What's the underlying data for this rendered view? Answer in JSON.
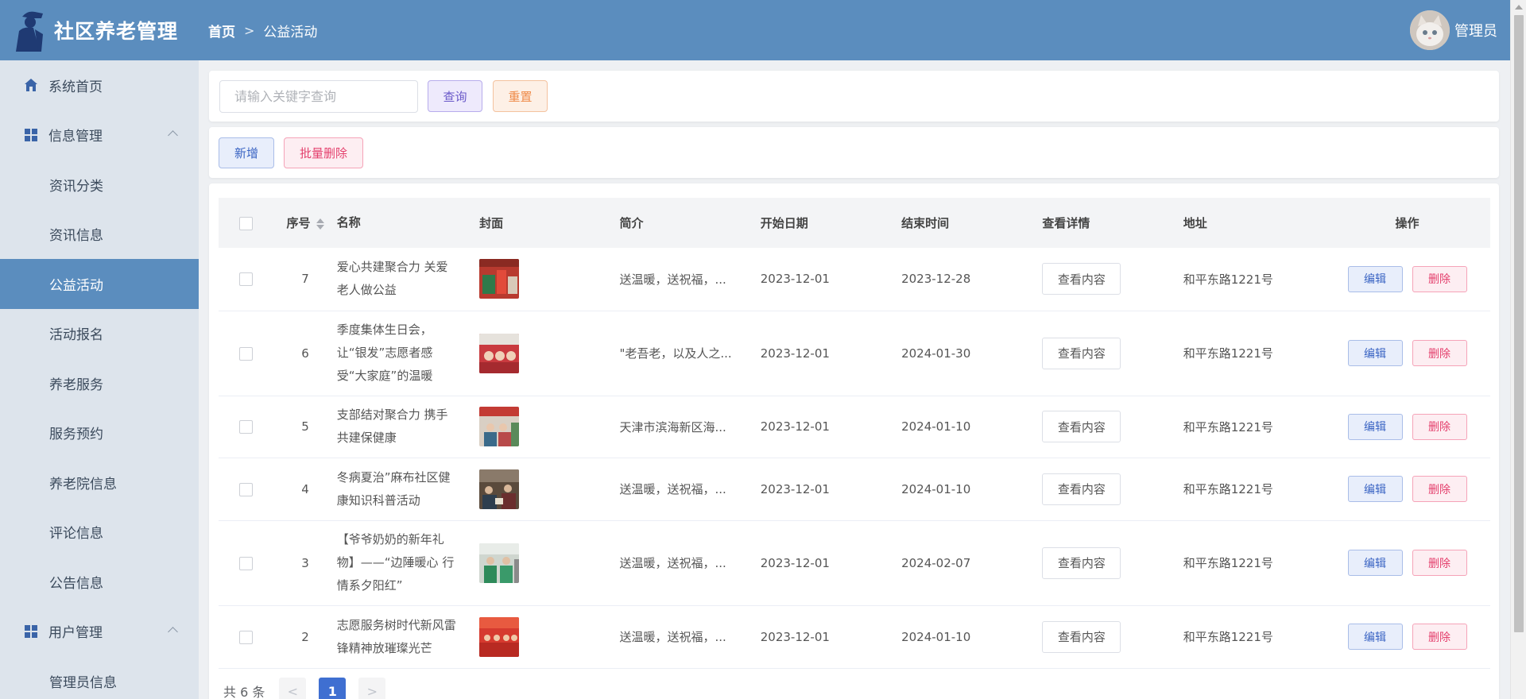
{
  "app": {
    "title": "社区养老管理"
  },
  "breadcrumb": {
    "home": "首页",
    "separator": ">",
    "current": "公益活动"
  },
  "user": {
    "name": "管理员"
  },
  "sidebar": {
    "items": [
      {
        "label": "系统首页",
        "icon": "home-icon"
      },
      {
        "label": "信息管理",
        "icon": "grid-icon"
      },
      {
        "label": "资讯分类"
      },
      {
        "label": "资讯信息"
      },
      {
        "label": "公益活动"
      },
      {
        "label": "活动报名"
      },
      {
        "label": "养老服务"
      },
      {
        "label": "服务预约"
      },
      {
        "label": "养老院信息"
      },
      {
        "label": "评论信息"
      },
      {
        "label": "公告信息"
      },
      {
        "label": "用户管理",
        "icon": "grid-icon"
      },
      {
        "label": "管理员信息"
      }
    ]
  },
  "search": {
    "placeholder": "请输入关键字查询",
    "query_label": "查询",
    "reset_label": "重置"
  },
  "actions": {
    "add_label": "新增",
    "batch_delete_label": "批量删除"
  },
  "table": {
    "headers": {
      "no": "序号",
      "name": "名称",
      "cover": "封面",
      "intro": "简介",
      "start": "开始日期",
      "end": "结束时间",
      "detail": "查看详情",
      "address": "地址",
      "ops": "操作"
    },
    "view_label": "查看内容",
    "edit_label": "编辑",
    "delete_label": "删除",
    "rows": [
      {
        "no": "7",
        "name": "爱心共建聚合力 关爱老人做公益",
        "intro": "送温暖，送祝福，...",
        "start": "2023-12-01",
        "end": "2023-12-28",
        "address": "和平东路1221号"
      },
      {
        "no": "6",
        "name": "季度集体生日会，让“银发”志愿者感受“大家庭”的温暖",
        "intro": "\"老吾老，以及人之...",
        "start": "2023-12-01",
        "end": "2024-01-30",
        "address": "和平东路1221号"
      },
      {
        "no": "5",
        "name": "支部结对聚合力 携手共建保健康",
        "intro": "天津市滨海新区海...",
        "start": "2023-12-01",
        "end": "2024-01-10",
        "address": "和平东路1221号"
      },
      {
        "no": "4",
        "name": "冬病夏治”麻布社区健康知识科普活动",
        "intro": "送温暖，送祝福，...",
        "start": "2023-12-01",
        "end": "2024-01-10",
        "address": "和平东路1221号"
      },
      {
        "no": "3",
        "name": "【爷爷奶奶的新年礼物】——“边陲暖心 行情系夕阳红”",
        "intro": "送温暖，送祝福，...",
        "start": "2023-12-01",
        "end": "2024-02-07",
        "address": "和平东路1221号"
      },
      {
        "no": "2",
        "name": "志愿服务树时代新风雷锋精神放璀璨光芒",
        "intro": "送温暖，送祝福，...",
        "start": "2023-12-01",
        "end": "2024-01-10",
        "address": "和平东路1221号"
      }
    ]
  },
  "pagination": {
    "total": "共 6 条",
    "current": "1",
    "prev": "<",
    "next": ">"
  },
  "colors": {
    "primary": "#5b8dbe",
    "sidebar_bg": "#dde4ec",
    "page_bg": "#eef0f3"
  }
}
